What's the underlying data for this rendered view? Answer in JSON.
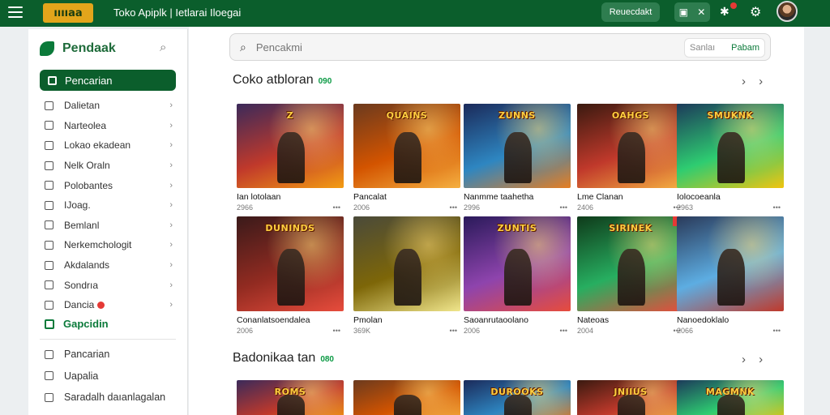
{
  "topbar": {
    "logo": "ııııaa",
    "title": "Toko Apiplk | Ietlarai  Iloegai",
    "action_button": "Reuecdakt",
    "icons": [
      "menu-icon",
      "grid-icon",
      "close-icon",
      "notification-icon",
      "settings-icon",
      "avatar"
    ]
  },
  "sidebar": {
    "title": "Pendaak",
    "active_item": "Pencarian",
    "items": [
      {
        "label": "Dalietan"
      },
      {
        "label": "Narteolea"
      },
      {
        "label": "Lokao ekadean"
      },
      {
        "label": "Nelk Oraln"
      },
      {
        "label": "Polobantes"
      },
      {
        "label": "IJoag."
      },
      {
        "label": "Bemlanl"
      },
      {
        "label": "Nerkemchologit"
      },
      {
        "label": "Akdalands"
      },
      {
        "label": "Sondrıa"
      },
      {
        "label": "Dancia"
      }
    ],
    "green_item": "Gapcidin",
    "bottom_items": [
      {
        "label": "Pancarian"
      },
      {
        "label": "Uapalia"
      },
      {
        "label": "Saradalh daıanlagalan"
      }
    ]
  },
  "search": {
    "placeholder": "Pencakmi",
    "pill_left": "Sanlaı",
    "pill_right": "Pabam"
  },
  "sections": [
    {
      "title": "Coko atbloran",
      "badge": "090",
      "rows": [
        [
          {
            "name": "Ian lotolaan",
            "meta": "2966",
            "art": "Z"
          },
          {
            "name": "Pancalat",
            "meta": "2006",
            "art": "QUAINS"
          },
          {
            "name": "Nanmme taahetha",
            "meta": "2996",
            "art": "ZUNNS"
          },
          {
            "name": "Lme Clanan",
            "meta": "2406",
            "art": "OAHGS"
          },
          {
            "name": "Iolocoeanla",
            "meta": "2963",
            "art": "SMUKNK"
          }
        ],
        [
          {
            "name": "Conanlatsoendalea",
            "meta": "2006",
            "art": "DUNINDS"
          },
          {
            "name": "Pmolan",
            "meta": "369K",
            "art": ""
          },
          {
            "name": "Saoanrutaoolano",
            "meta": "2006",
            "art": "ZUNTIS"
          },
          {
            "name": "Nateoas",
            "meta": "2004",
            "art": "SIRINEK"
          },
          {
            "name": "Nanoedoklalo",
            "meta": "2066",
            "art": ""
          }
        ]
      ]
    },
    {
      "title": "Badonikaa tan",
      "badge": "080",
      "rows": [
        [
          {
            "name": "",
            "meta": "",
            "art": "ROMS"
          },
          {
            "name": "",
            "meta": "",
            "art": ""
          },
          {
            "name": "",
            "meta": "",
            "art": "DUROOKS"
          },
          {
            "name": "",
            "meta": "",
            "art": "JNJIUS"
          },
          {
            "name": "",
            "meta": "",
            "art": "MAGMNK"
          }
        ]
      ]
    }
  ],
  "colors": {
    "brand": "#0b5e2c",
    "accent": "#0b9a44",
    "logo": "#e2a51b"
  }
}
